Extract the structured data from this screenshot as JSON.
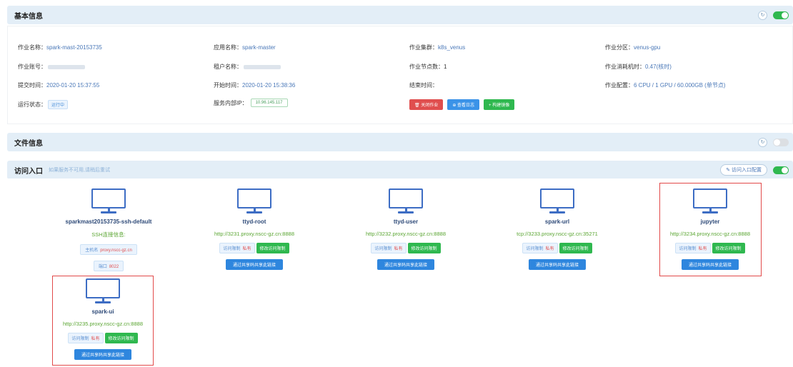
{
  "basic": {
    "title": "基本信息",
    "job_name_label": "作业名称：",
    "job_name": "spark-mast-20153735",
    "app_name_label": "应用名称：",
    "app_name": "spark-master",
    "cluster_label": "作业集群：",
    "cluster": "k8s_venus",
    "partition_label": "作业分区：",
    "partition": "venus-gpu",
    "account_label": "作业账号：",
    "tenant_label": "租户名称：",
    "nodes_label": "作业节点数：",
    "nodes": "1",
    "cost_label": "作业消耗机时：",
    "cost": "0.47(核时)",
    "submit_label": "提交时间：",
    "submit_time": "2020-01-20 15:37:55",
    "start_label": "开始时间：",
    "start_time": "2020-01-20 15:38:36",
    "end_label": "结束时间：",
    "config_label": "作业配置：",
    "config": "6 CPU / 1 GPU / 60.000GB (单节点)",
    "status_label": "运行状态：",
    "status": "运行中",
    "ip_label": "服务内部IP：",
    "ip": "10.96.145.117",
    "btn_close": "关闭作业",
    "btn_logs": "查看日志",
    "btn_mirror": "构建镜像"
  },
  "files": {
    "title": "文件信息"
  },
  "entries": {
    "title": "访问入口",
    "hint": "如果服务不可用,请稍后重试",
    "config_btn": "访问入口配置",
    "perm_label": "访问限制",
    "perm_value": "私有",
    "edit_perm": "修改访问限制",
    "share": "通过共享码共享此链接",
    "ssh_host_label": "主机名",
    "ssh_host": "proxy.nscc-gz.cn",
    "ssh_port_label": "端口",
    "ssh_port": "8022",
    "cards": [
      {
        "name": "sparkmast20153735-ssh-default",
        "url": "SSH连接信息:"
      },
      {
        "name": "ttyd-root",
        "url": "http://3231.proxy.nscc-gz.cn:8888"
      },
      {
        "name": "ttyd-user",
        "url": "http://3232.proxy.nscc-gz.cn:8888"
      },
      {
        "name": "spark-url",
        "url": "tcp://3233.proxy.nscc-gz.cn:35271"
      },
      {
        "name": "jupyter",
        "url": "http://3234.proxy.nscc-gz.cn:8888"
      },
      {
        "name": "spark-ui",
        "url": "http://3235.proxy.nscc-gz.cn:8888"
      }
    ]
  },
  "icons": {
    "refresh": "refresh-icon",
    "monitor": "monitor-icon"
  },
  "colors": {
    "accent": "#3b93e8",
    "success": "#2fb84f",
    "danger": "#e04e4e",
    "highlight": "#e24a4a"
  }
}
